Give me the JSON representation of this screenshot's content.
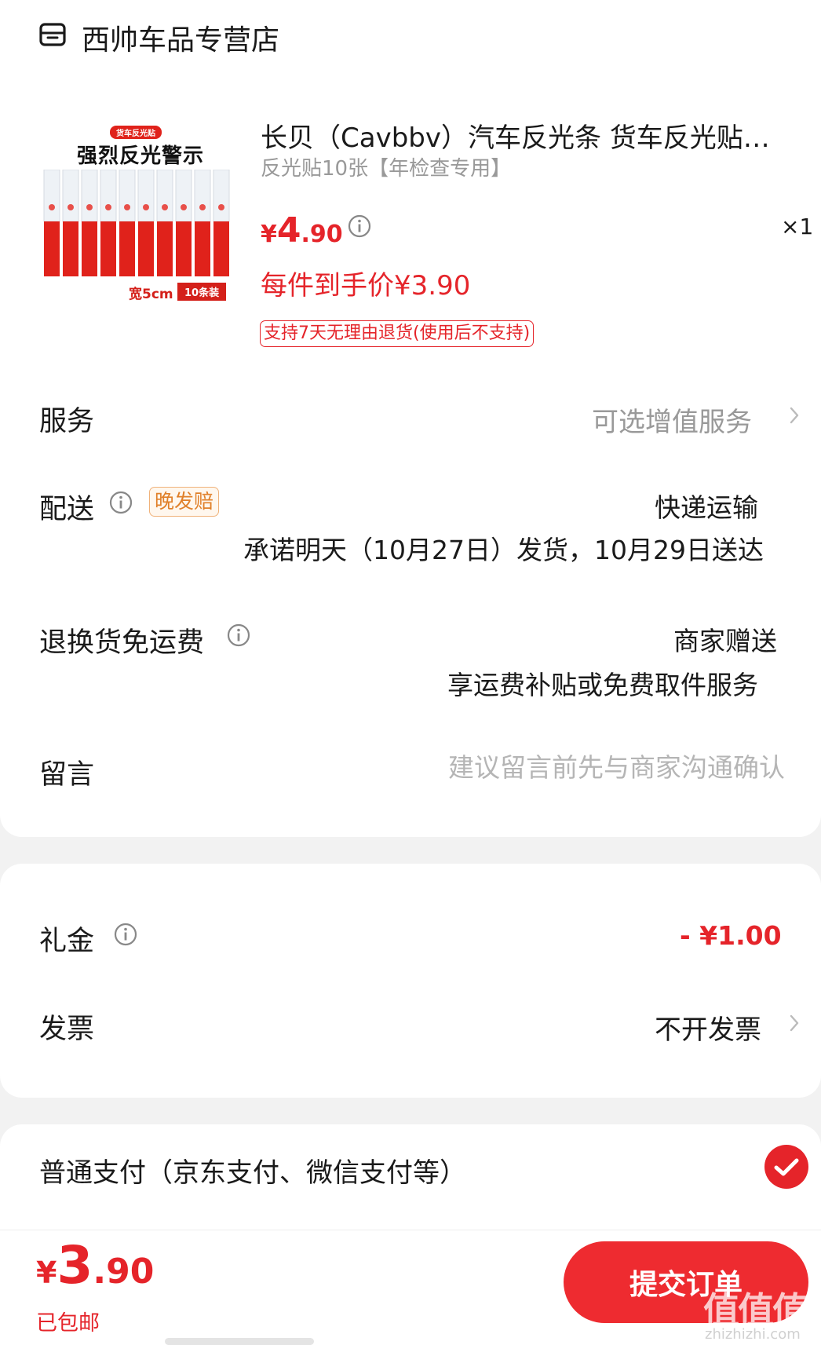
{
  "store": {
    "name": "西帅车品专营店",
    "icon": "store-icon"
  },
  "product": {
    "title": "长贝（Cavbbv）汽车反光条 货车反光贴…",
    "spec": "反光贴10张【年检查专用】",
    "price": {
      "currency": "¥",
      "integer": "4",
      "decimal": ".90"
    },
    "quantity": "×1",
    "final_price": "每件到手价¥3.90",
    "return_policy": "支持7天无理由退货(使用后不支持)",
    "image": {
      "badge": "货车反光贴",
      "headline": "强烈反光警示",
      "width_text": "宽5cm",
      "count_text": "10条装"
    }
  },
  "service": {
    "label": "服务",
    "value": "可选增值服务"
  },
  "delivery": {
    "label": "配送",
    "badge": "晚发赔",
    "method": "快递运输",
    "promise": "承诺明天（10月27日）发货，10月29日送达"
  },
  "return_shipping": {
    "label": "退换货免运费",
    "gift": "商家赠送",
    "service": "享运费补贴或免费取件服务"
  },
  "message": {
    "label": "留言",
    "placeholder": "建议留言前先与商家沟通确认",
    "value": ""
  },
  "gift_money": {
    "label": "礼金",
    "value": "- ¥1.00"
  },
  "invoice": {
    "label": "发票",
    "value": "不开发票"
  },
  "payment": {
    "label": "普通支付（京东支付、微信支付等）",
    "selected": true
  },
  "bottom": {
    "total": {
      "currency": "¥",
      "integer": "3",
      "decimal": ".90"
    },
    "shipping": "已包邮",
    "submit_label": "提交订单"
  },
  "watermark": {
    "logo": "值值值",
    "url": "zhizhizhi.com"
  },
  "colors": {
    "accent": "#e5242a",
    "button": "#ee2b30",
    "muted": "#999999",
    "badge_orange": "#e0802a"
  }
}
